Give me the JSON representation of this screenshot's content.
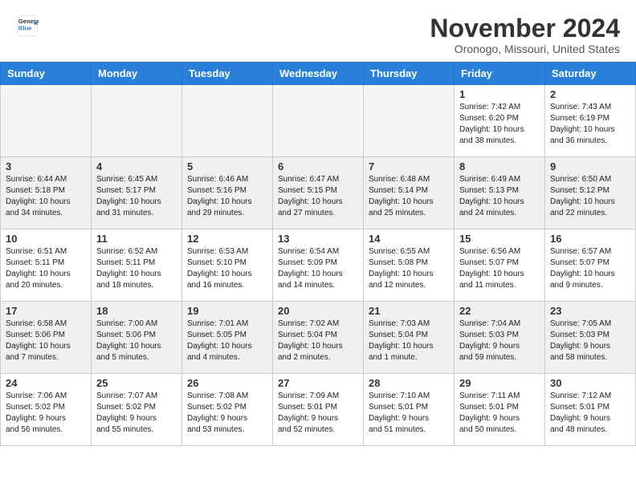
{
  "header": {
    "logo_line1": "General",
    "logo_line2": "Blue",
    "month": "November 2024",
    "location": "Oronogo, Missouri, United States"
  },
  "weekdays": [
    "Sunday",
    "Monday",
    "Tuesday",
    "Wednesday",
    "Thursday",
    "Friday",
    "Saturday"
  ],
  "weeks": [
    [
      {
        "day": "",
        "info": ""
      },
      {
        "day": "",
        "info": ""
      },
      {
        "day": "",
        "info": ""
      },
      {
        "day": "",
        "info": ""
      },
      {
        "day": "",
        "info": ""
      },
      {
        "day": "1",
        "info": "Sunrise: 7:42 AM\nSunset: 6:20 PM\nDaylight: 10 hours\nand 38 minutes."
      },
      {
        "day": "2",
        "info": "Sunrise: 7:43 AM\nSunset: 6:19 PM\nDaylight: 10 hours\nand 36 minutes."
      }
    ],
    [
      {
        "day": "3",
        "info": "Sunrise: 6:44 AM\nSunset: 5:18 PM\nDaylight: 10 hours\nand 34 minutes."
      },
      {
        "day": "4",
        "info": "Sunrise: 6:45 AM\nSunset: 5:17 PM\nDaylight: 10 hours\nand 31 minutes."
      },
      {
        "day": "5",
        "info": "Sunrise: 6:46 AM\nSunset: 5:16 PM\nDaylight: 10 hours\nand 29 minutes."
      },
      {
        "day": "6",
        "info": "Sunrise: 6:47 AM\nSunset: 5:15 PM\nDaylight: 10 hours\nand 27 minutes."
      },
      {
        "day": "7",
        "info": "Sunrise: 6:48 AM\nSunset: 5:14 PM\nDaylight: 10 hours\nand 25 minutes."
      },
      {
        "day": "8",
        "info": "Sunrise: 6:49 AM\nSunset: 5:13 PM\nDaylight: 10 hours\nand 24 minutes."
      },
      {
        "day": "9",
        "info": "Sunrise: 6:50 AM\nSunset: 5:12 PM\nDaylight: 10 hours\nand 22 minutes."
      }
    ],
    [
      {
        "day": "10",
        "info": "Sunrise: 6:51 AM\nSunset: 5:11 PM\nDaylight: 10 hours\nand 20 minutes."
      },
      {
        "day": "11",
        "info": "Sunrise: 6:52 AM\nSunset: 5:11 PM\nDaylight: 10 hours\nand 18 minutes."
      },
      {
        "day": "12",
        "info": "Sunrise: 6:53 AM\nSunset: 5:10 PM\nDaylight: 10 hours\nand 16 minutes."
      },
      {
        "day": "13",
        "info": "Sunrise: 6:54 AM\nSunset: 5:09 PM\nDaylight: 10 hours\nand 14 minutes."
      },
      {
        "day": "14",
        "info": "Sunrise: 6:55 AM\nSunset: 5:08 PM\nDaylight: 10 hours\nand 12 minutes."
      },
      {
        "day": "15",
        "info": "Sunrise: 6:56 AM\nSunset: 5:07 PM\nDaylight: 10 hours\nand 11 minutes."
      },
      {
        "day": "16",
        "info": "Sunrise: 6:57 AM\nSunset: 5:07 PM\nDaylight: 10 hours\nand 9 minutes."
      }
    ],
    [
      {
        "day": "17",
        "info": "Sunrise: 6:58 AM\nSunset: 5:06 PM\nDaylight: 10 hours\nand 7 minutes."
      },
      {
        "day": "18",
        "info": "Sunrise: 7:00 AM\nSunset: 5:06 PM\nDaylight: 10 hours\nand 5 minutes."
      },
      {
        "day": "19",
        "info": "Sunrise: 7:01 AM\nSunset: 5:05 PM\nDaylight: 10 hours\nand 4 minutes."
      },
      {
        "day": "20",
        "info": "Sunrise: 7:02 AM\nSunset: 5:04 PM\nDaylight: 10 hours\nand 2 minutes."
      },
      {
        "day": "21",
        "info": "Sunrise: 7:03 AM\nSunset: 5:04 PM\nDaylight: 10 hours\nand 1 minute."
      },
      {
        "day": "22",
        "info": "Sunrise: 7:04 AM\nSunset: 5:03 PM\nDaylight: 9 hours\nand 59 minutes."
      },
      {
        "day": "23",
        "info": "Sunrise: 7:05 AM\nSunset: 5:03 PM\nDaylight: 9 hours\nand 58 minutes."
      }
    ],
    [
      {
        "day": "24",
        "info": "Sunrise: 7:06 AM\nSunset: 5:02 PM\nDaylight: 9 hours\nand 56 minutes."
      },
      {
        "day": "25",
        "info": "Sunrise: 7:07 AM\nSunset: 5:02 PM\nDaylight: 9 hours\nand 55 minutes."
      },
      {
        "day": "26",
        "info": "Sunrise: 7:08 AM\nSunset: 5:02 PM\nDaylight: 9 hours\nand 53 minutes."
      },
      {
        "day": "27",
        "info": "Sunrise: 7:09 AM\nSunset: 5:01 PM\nDaylight: 9 hours\nand 52 minutes."
      },
      {
        "day": "28",
        "info": "Sunrise: 7:10 AM\nSunset: 5:01 PM\nDaylight: 9 hours\nand 51 minutes."
      },
      {
        "day": "29",
        "info": "Sunrise: 7:11 AM\nSunset: 5:01 PM\nDaylight: 9 hours\nand 50 minutes."
      },
      {
        "day": "30",
        "info": "Sunrise: 7:12 AM\nSunset: 5:01 PM\nDaylight: 9 hours\nand 48 minutes."
      }
    ]
  ]
}
